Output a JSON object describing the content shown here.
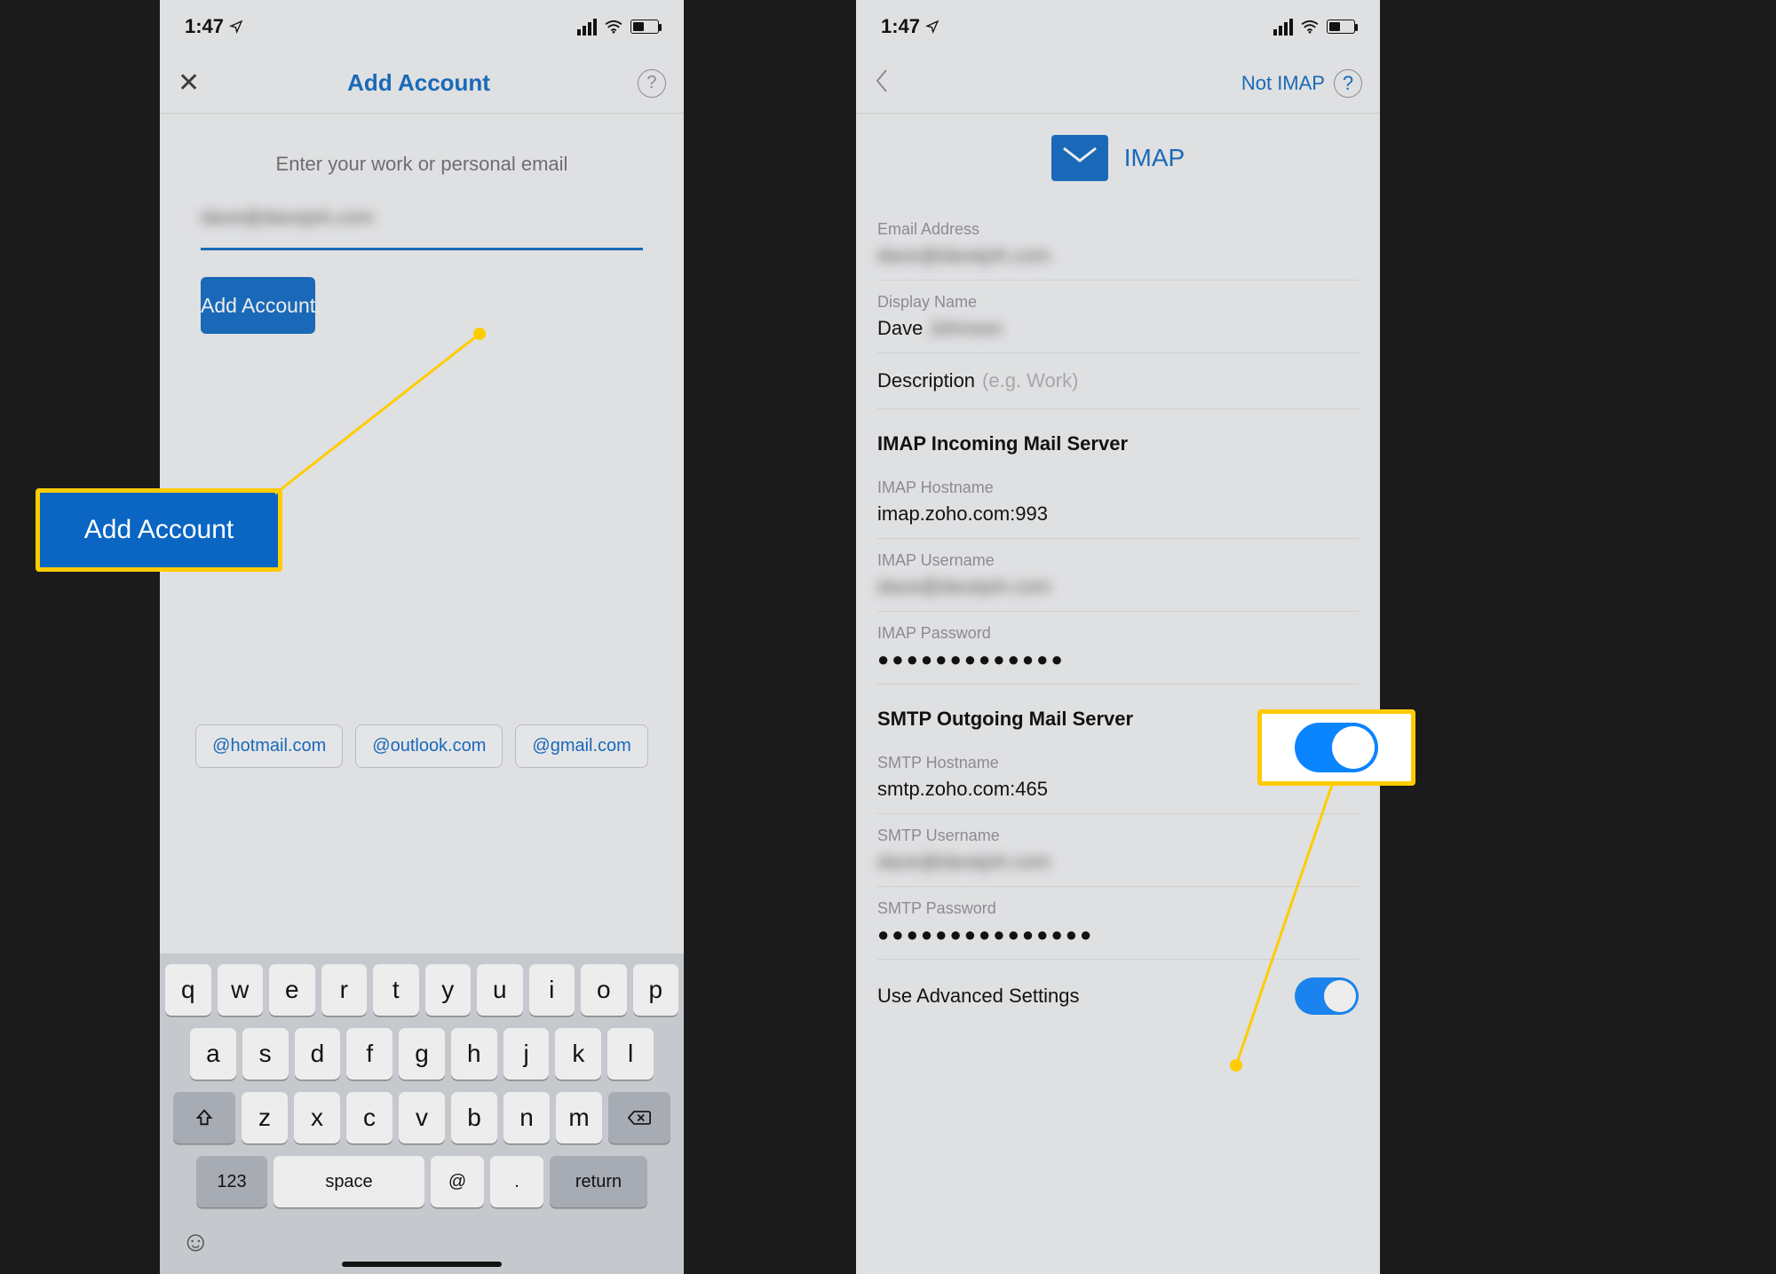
{
  "status": {
    "time": "1:47"
  },
  "left": {
    "title": "Add Account",
    "prompt": "Enter your work or personal email",
    "email_value": "dave@davejoh.com",
    "add_button": "Add Account",
    "chips": [
      "@hotmail.com",
      "@outlook.com",
      "@gmail.com"
    ],
    "keyboard": {
      "row1": [
        "q",
        "w",
        "e",
        "r",
        "t",
        "y",
        "u",
        "i",
        "o",
        "p"
      ],
      "row2": [
        "a",
        "s",
        "d",
        "f",
        "g",
        "h",
        "j",
        "k",
        "l"
      ],
      "row3_letters": [
        "z",
        "x",
        "c",
        "v",
        "b",
        "n",
        "m"
      ],
      "num_key": "123",
      "space_key": "space",
      "at_key": "@",
      "dot_key": ".",
      "return_key": "return"
    }
  },
  "left_callout": "Add Account",
  "right": {
    "not_imap": "Not IMAP",
    "imap_label": "IMAP",
    "email_label": "Email Address",
    "email_value": "dave@davejoh.com",
    "display_label": "Display Name",
    "display_value_visible": "Dave",
    "display_value_blurred": "Johnson",
    "desc_label": "Description",
    "desc_hint": "(e.g. Work)",
    "imap_section": "IMAP Incoming Mail Server",
    "imap_host_label": "IMAP Hostname",
    "imap_host_value": "imap.zoho.com:993",
    "imap_user_label": "IMAP Username",
    "imap_user_value": "dave@davejoh.com",
    "imap_pass_label": "IMAP Password",
    "imap_pass_value": "●●●●●●●●●●●●●",
    "smtp_section": "SMTP Outgoing Mail Server",
    "smtp_host_label": "SMTP Hostname",
    "smtp_host_value": "smtp.zoho.com:465",
    "smtp_user_label": "SMTP Username",
    "smtp_user_value": "dave@davejoh.com",
    "smtp_pass_label": "SMTP Password",
    "smtp_pass_value": "●●●●●●●●●●●●●●●",
    "advanced_label": "Use Advanced Settings"
  }
}
